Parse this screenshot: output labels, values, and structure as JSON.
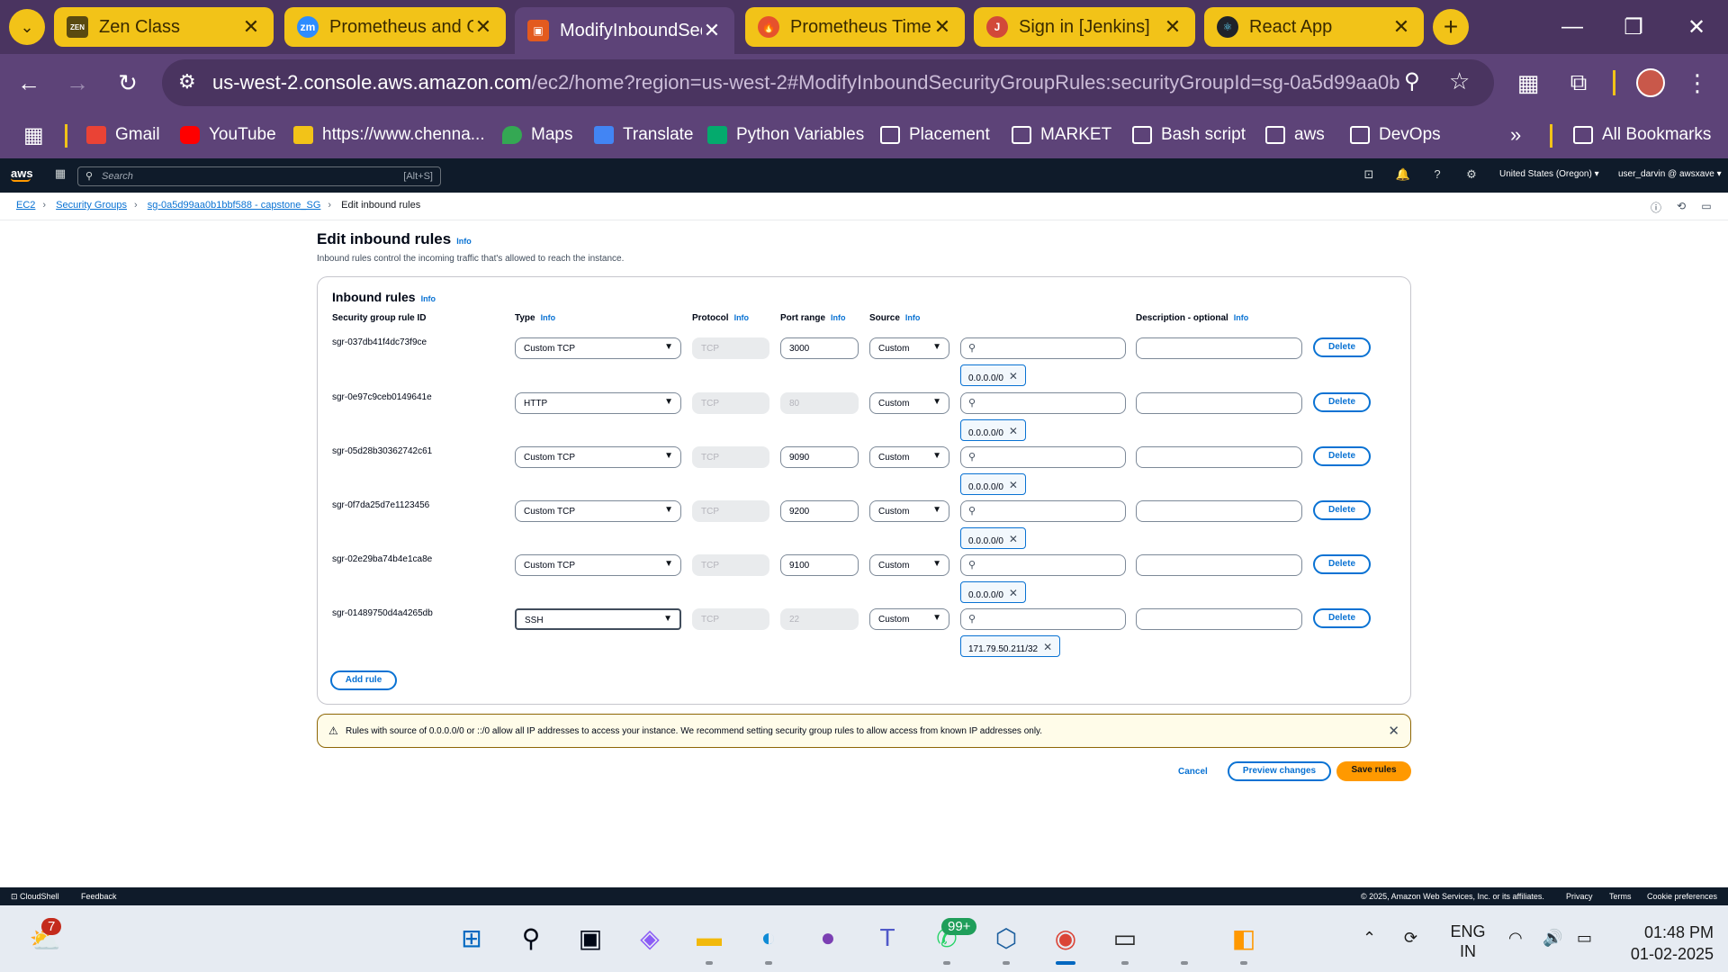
{
  "browser": {
    "tabs": [
      {
        "title": "Zen Class",
        "icon": "zen-class-icon",
        "active": false
      },
      {
        "title": "Prometheus and G",
        "icon": "zoom-icon",
        "active": false
      },
      {
        "title": "ModifyInboundSec",
        "icon": "aws-ec2-icon",
        "active": true
      },
      {
        "title": "Prometheus Time S",
        "icon": "prometheus-icon",
        "active": false
      },
      {
        "title": "Sign in [Jenkins]",
        "icon": "jenkins-icon",
        "active": false
      },
      {
        "title": "React App",
        "icon": "react-icon",
        "active": false
      }
    ],
    "url_host": "us-west-2.console.aws.amazon.com",
    "url_path": "/ec2/home?region=us-west-2#ModifyInboundSecurityGroupRules:securityGroupId=sg-0a5d99aa0b1bb...",
    "bookmarks": [
      {
        "label": "Gmail",
        "icon": "gmail-icon"
      },
      {
        "label": "YouTube",
        "icon": "youtube-icon"
      },
      {
        "label": "https://www.chenna...",
        "icon": "site-icon"
      },
      {
        "label": "Maps",
        "icon": "maps-icon"
      },
      {
        "label": "Translate",
        "icon": "translate-icon"
      },
      {
        "label": "Python Variables",
        "icon": "w3schools-icon"
      },
      {
        "label": "Placement",
        "icon": "folder-icon"
      },
      {
        "label": "MARKET",
        "icon": "folder-icon"
      },
      {
        "label": "Bash script",
        "icon": "folder-icon"
      },
      {
        "label": "aws",
        "icon": "folder-icon"
      },
      {
        "label": "DevOps",
        "icon": "folder-icon"
      }
    ],
    "all_bookmarks": "All Bookmarks"
  },
  "aws_header": {
    "logo": "aws",
    "search_placeholder": "Search",
    "search_shortcut": "[Alt+S]",
    "region": "United States (Oregon) ▾",
    "user": "user_darvin @ awsxave ▾"
  },
  "breadcrumb": [
    "EC2",
    "Security Groups",
    "sg-0a5d99aa0b1bbf588 - capstone_SG",
    "Edit inbound rules"
  ],
  "page": {
    "title": "Edit inbound rules",
    "info": "Info",
    "description": "Inbound rules control the incoming traffic that's allowed to reach the instance."
  },
  "panel": {
    "title": "Inbound rules",
    "info": "Info",
    "columns": {
      "rule_id": "Security group rule ID",
      "type": "Type",
      "protocol": "Protocol",
      "port_range": "Port range",
      "source": "Source",
      "description": "Description - optional"
    },
    "rules": [
      {
        "id": "sgr-037db41f4dc73f9ce",
        "type": "Custom TCP",
        "protocol": "TCP",
        "port": "3000",
        "port_editable": true,
        "source": "Custom",
        "cidr": "0.0.0.0/0"
      },
      {
        "id": "sgr-0e97c9ceb0149641e",
        "type": "HTTP",
        "protocol": "TCP",
        "port": "80",
        "port_editable": false,
        "source": "Custom",
        "cidr": "0.0.0.0/0"
      },
      {
        "id": "sgr-05d28b30362742c61",
        "type": "Custom TCP",
        "protocol": "TCP",
        "port": "9090",
        "port_editable": true,
        "source": "Custom",
        "cidr": "0.0.0.0/0"
      },
      {
        "id": "sgr-0f7da25d7e1123456",
        "type": "Custom TCP",
        "protocol": "TCP",
        "port": "9200",
        "port_editable": true,
        "source": "Custom",
        "cidr": "0.0.0.0/0"
      },
      {
        "id": "sgr-02e29ba74b4e1ca8e",
        "type": "Custom TCP",
        "protocol": "TCP",
        "port": "9100",
        "port_editable": true,
        "source": "Custom",
        "cidr": "0.0.0.0/0"
      },
      {
        "id": "sgr-01489750d4a4265db",
        "type": "SSH",
        "protocol": "TCP",
        "port": "22",
        "port_editable": false,
        "source": "Custom",
        "cidr": "171.79.50.211/32"
      }
    ],
    "delete_label": "Delete",
    "add_rule_label": "Add rule"
  },
  "warning": "Rules with source of 0.0.0.0/0 or ::/0 allow all IP addresses to access your instance. We recommend setting security group rules to allow access from known IP addresses only.",
  "actions": {
    "cancel": "Cancel",
    "preview": "Preview changes",
    "save": "Save rules"
  },
  "aws_footer": {
    "cloudshell": "CloudShell",
    "feedback": "Feedback",
    "copyright": "© 2025, Amazon Web Services, Inc. or its affiliates.",
    "privacy": "Privacy",
    "terms": "Terms",
    "cookies": "Cookie preferences"
  },
  "taskbar": {
    "weather_badge": "7",
    "whatsapp_badge": "99+",
    "lang_line1": "ENG",
    "lang_line2": "IN",
    "time": "01:48 PM",
    "date": "01-02-2025"
  },
  "colors": {
    "chrome_dark": "#4a3460",
    "chrome": "#5d4378",
    "tab_yellow": "#f2c318",
    "aws_orange": "#ff9900",
    "link_blue": "#0972d3"
  }
}
